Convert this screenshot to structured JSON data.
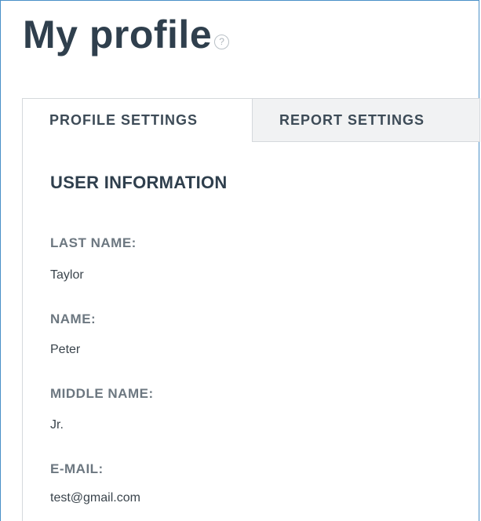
{
  "page": {
    "title": "My profile",
    "help_icon": "question-mark-circle-icon",
    "help_glyph": "?"
  },
  "tabs": [
    {
      "label": "PROFILE SETTINGS",
      "active": true
    },
    {
      "label": "REPORT SETTINGS",
      "active": false
    }
  ],
  "user_information": {
    "heading": "USER INFORMATION",
    "fields": [
      {
        "label": "LAST NAME:",
        "value": "Taylor"
      },
      {
        "label": "NAME:",
        "value": "Peter"
      },
      {
        "label": "MIDDLE NAME:",
        "value": "Jr."
      },
      {
        "label": "E-MAIL:",
        "value": "test@gmail.com"
      }
    ]
  },
  "colors": {
    "title": "#2f3f4d",
    "label": "#6c7780",
    "frame_border": "#4a90c8",
    "inactive_tab_bg": "#f1f2f3"
  }
}
